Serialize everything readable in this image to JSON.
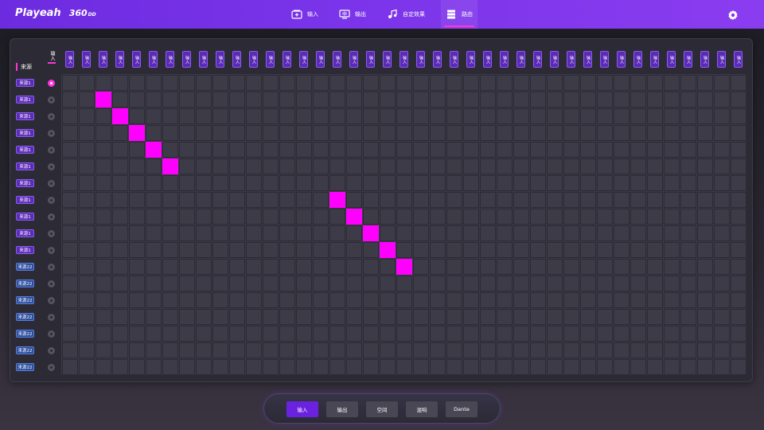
{
  "header": {
    "brand": "Playeah",
    "model": "360",
    "model_suffix": "DD",
    "nav": [
      {
        "label": "输入",
        "icon": "input-icon",
        "active": false
      },
      {
        "label": "输出",
        "icon": "output-icon",
        "active": false
      },
      {
        "label": "自定效果",
        "icon": "custom-effect-icon",
        "active": false
      },
      {
        "label": "路由",
        "icon": "routing-icon",
        "active": true
      }
    ],
    "settings_icon": "gear-icon"
  },
  "matrix": {
    "corner_source_label": "来源",
    "corner_input_label": "输入",
    "columns": [
      "输入",
      "输入",
      "输入",
      "输入",
      "输入",
      "输入",
      "输入",
      "输入",
      "输入",
      "输入",
      "输入",
      "输入",
      "输入",
      "输入",
      "输入",
      "输入",
      "输入",
      "输入",
      "输入",
      "输入",
      "输入",
      "输入",
      "输入",
      "输入",
      "输入",
      "输入",
      "输入",
      "输入",
      "输入",
      "输入",
      "输入",
      "输入",
      "输入",
      "输入",
      "输入",
      "输入",
      "输入",
      "输入",
      "输入",
      "输入",
      "输入"
    ],
    "rows": [
      {
        "label": "来源1",
        "selected": true
      },
      {
        "label": "来源1",
        "selected": false
      },
      {
        "label": "来源1",
        "selected": false
      },
      {
        "label": "来源1",
        "selected": false
      },
      {
        "label": "来源1",
        "selected": false
      },
      {
        "label": "来源1",
        "selected": false
      },
      {
        "label": "来源1",
        "selected": false
      },
      {
        "label": "来源1",
        "selected": false
      },
      {
        "label": "来源1",
        "selected": false
      },
      {
        "label": "来源1",
        "selected": false
      },
      {
        "label": "来源1",
        "selected": false
      },
      {
        "label": "来源22",
        "selected": false
      },
      {
        "label": "来源22",
        "selected": false
      },
      {
        "label": "来源22",
        "selected": false
      },
      {
        "label": "来源22",
        "selected": false
      },
      {
        "label": "来源22",
        "selected": false
      },
      {
        "label": "来源22",
        "selected": false
      },
      {
        "label": "来源22",
        "selected": false
      }
    ],
    "active_routes": [
      [
        1,
        2
      ],
      [
        2,
        3
      ],
      [
        3,
        4
      ],
      [
        4,
        5
      ],
      [
        5,
        6
      ],
      [
        7,
        16
      ],
      [
        8,
        17
      ],
      [
        9,
        18
      ],
      [
        10,
        19
      ],
      [
        11,
        20
      ]
    ],
    "route_color": "#ff00ff"
  },
  "footer": {
    "tabs": [
      {
        "label": "输入",
        "active": true
      },
      {
        "label": "输出",
        "active": false
      },
      {
        "label": "空间",
        "active": false
      },
      {
        "label": "混响",
        "active": false
      },
      {
        "label": "Dante",
        "active": false
      }
    ]
  },
  "colors": {
    "accent": "#7c35ea",
    "highlight": "#ff33dd"
  }
}
